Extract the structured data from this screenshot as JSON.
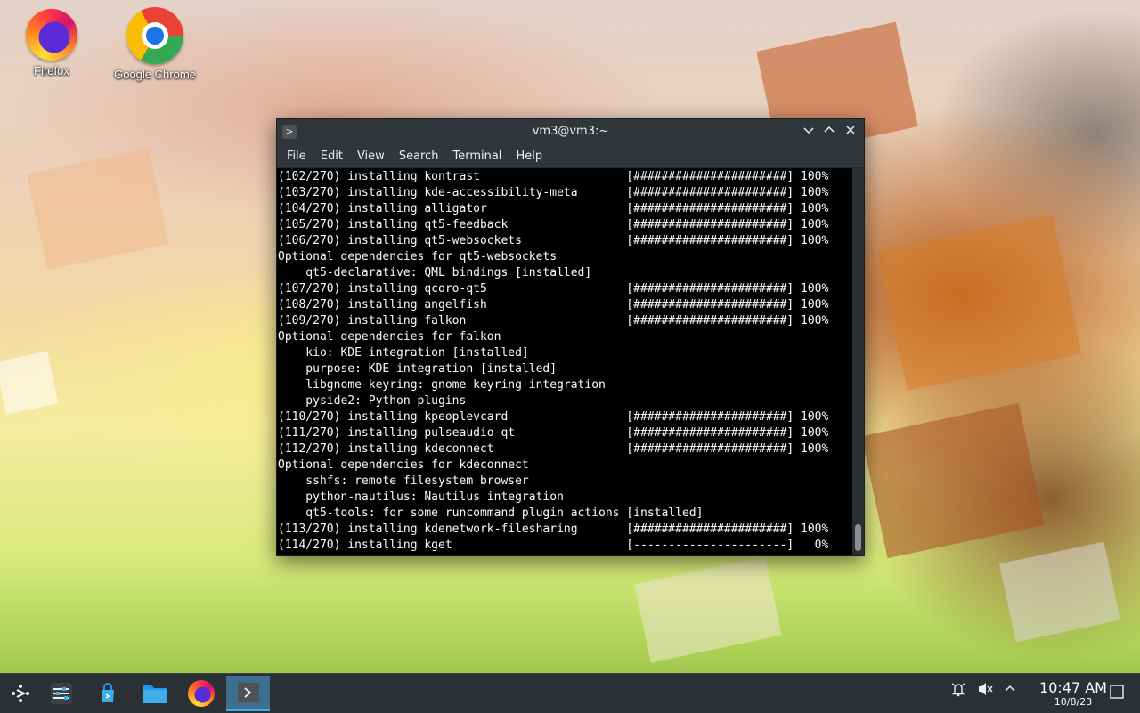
{
  "desktop": {
    "icons": [
      {
        "label": "Firefox",
        "icon": "firefox-icon"
      },
      {
        "label": "Google Chrome",
        "icon": "chrome-icon"
      }
    ]
  },
  "window": {
    "title": "vm3@vm3:~",
    "menu": [
      "File",
      "Edit",
      "View",
      "Search",
      "Terminal",
      "Help"
    ],
    "controls": [
      "minimize-icon",
      "maximize-icon",
      "close-icon"
    ]
  },
  "terminal": {
    "lines": [
      "(102/270) installing kontrast                     [######################] 100%",
      "(103/270) installing kde-accessibility-meta       [######################] 100%",
      "(104/270) installing alligator                    [######################] 100%",
      "(105/270) installing qt5-feedback                 [######################] 100%",
      "(106/270) installing qt5-websockets               [######################] 100%",
      "Optional dependencies for qt5-websockets",
      "    qt5-declarative: QML bindings [installed]",
      "(107/270) installing qcoro-qt5                    [######################] 100%",
      "(108/270) installing angelfish                    [######################] 100%",
      "(109/270) installing falkon                       [######################] 100%",
      "Optional dependencies for falkon",
      "    kio: KDE integration [installed]",
      "    purpose: KDE integration [installed]",
      "    libgnome-keyring: gnome keyring integration",
      "    pyside2: Python plugins",
      "(110/270) installing kpeoplevcard                 [######################] 100%",
      "(111/270) installing pulseaudio-qt                [######################] 100%",
      "(112/270) installing kdeconnect                   [######################] 100%",
      "Optional dependencies for kdeconnect",
      "    sshfs: remote filesystem browser",
      "    python-nautilus: Nautilus integration",
      "    qt5-tools: for some runcommand plugin actions [installed]",
      "(113/270) installing kdenetwork-filesharing       [######################] 100%",
      "(114/270) installing kget                         [----------------------]   0%"
    ]
  },
  "taskbar": {
    "apps": [
      "application-launcher-icon",
      "system-settings-icon",
      "discover-icon",
      "dolphin-files-icon",
      "firefox-icon",
      "konsole-icon"
    ],
    "tray": [
      "notifications-icon",
      "volume-muted-icon",
      "show-hidden-icons-chevron",
      "show-desktop-icon"
    ],
    "clock": {
      "time": "10:47 AM",
      "date": "10/8/23"
    }
  }
}
